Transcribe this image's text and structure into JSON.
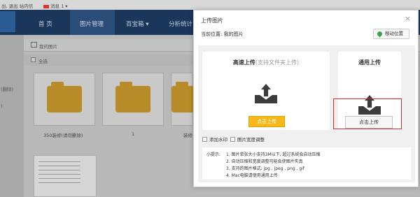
{
  "topbar": {
    "links_text": "出, 退出  站内信",
    "message_label": "消息",
    "message_count": "1"
  },
  "nav": {
    "items": [
      "首 页",
      "图片管理",
      "百宝箱",
      "分析统计"
    ]
  },
  "sidebar_fragments": [
    "(删除)",
    ")"
  ],
  "library": {
    "breadcrumb": "我的图片",
    "select_all": "全选",
    "cards": [
      {
        "label": "350装修(请勿删除)"
      },
      {
        "label": "1"
      },
      {
        "label": "装修"
      }
    ]
  },
  "modal": {
    "title": "上传图片",
    "close_symbol": "×",
    "location_label": "当前位置:",
    "location_value": "我的图片",
    "change_location_button": "移动位置",
    "fast_upload": {
      "title": "高速上传",
      "note": "(支持文件夹上传)",
      "button": "点击上传"
    },
    "normal_upload": {
      "title": "通用上传",
      "button": "点击上传"
    },
    "options": [
      "添加水印",
      "图片宽度调整"
    ],
    "tips": {
      "heading": "小提示:",
      "lines": [
        "1. 图片单张大小支持3M以下, 超过系统会自动压缩",
        "2. 自动压缩和宽度调整可能会使图片失真",
        "3. 支持的图片格式: jpg , jpeg , png , gif",
        "4. Mac电脑请使用通用上传"
      ]
    }
  },
  "colors": {
    "nav_bg": "#1a365a",
    "yellow_button": "#f6b81b",
    "highlight": "#e0262a",
    "location_pin": "#3aa547"
  }
}
